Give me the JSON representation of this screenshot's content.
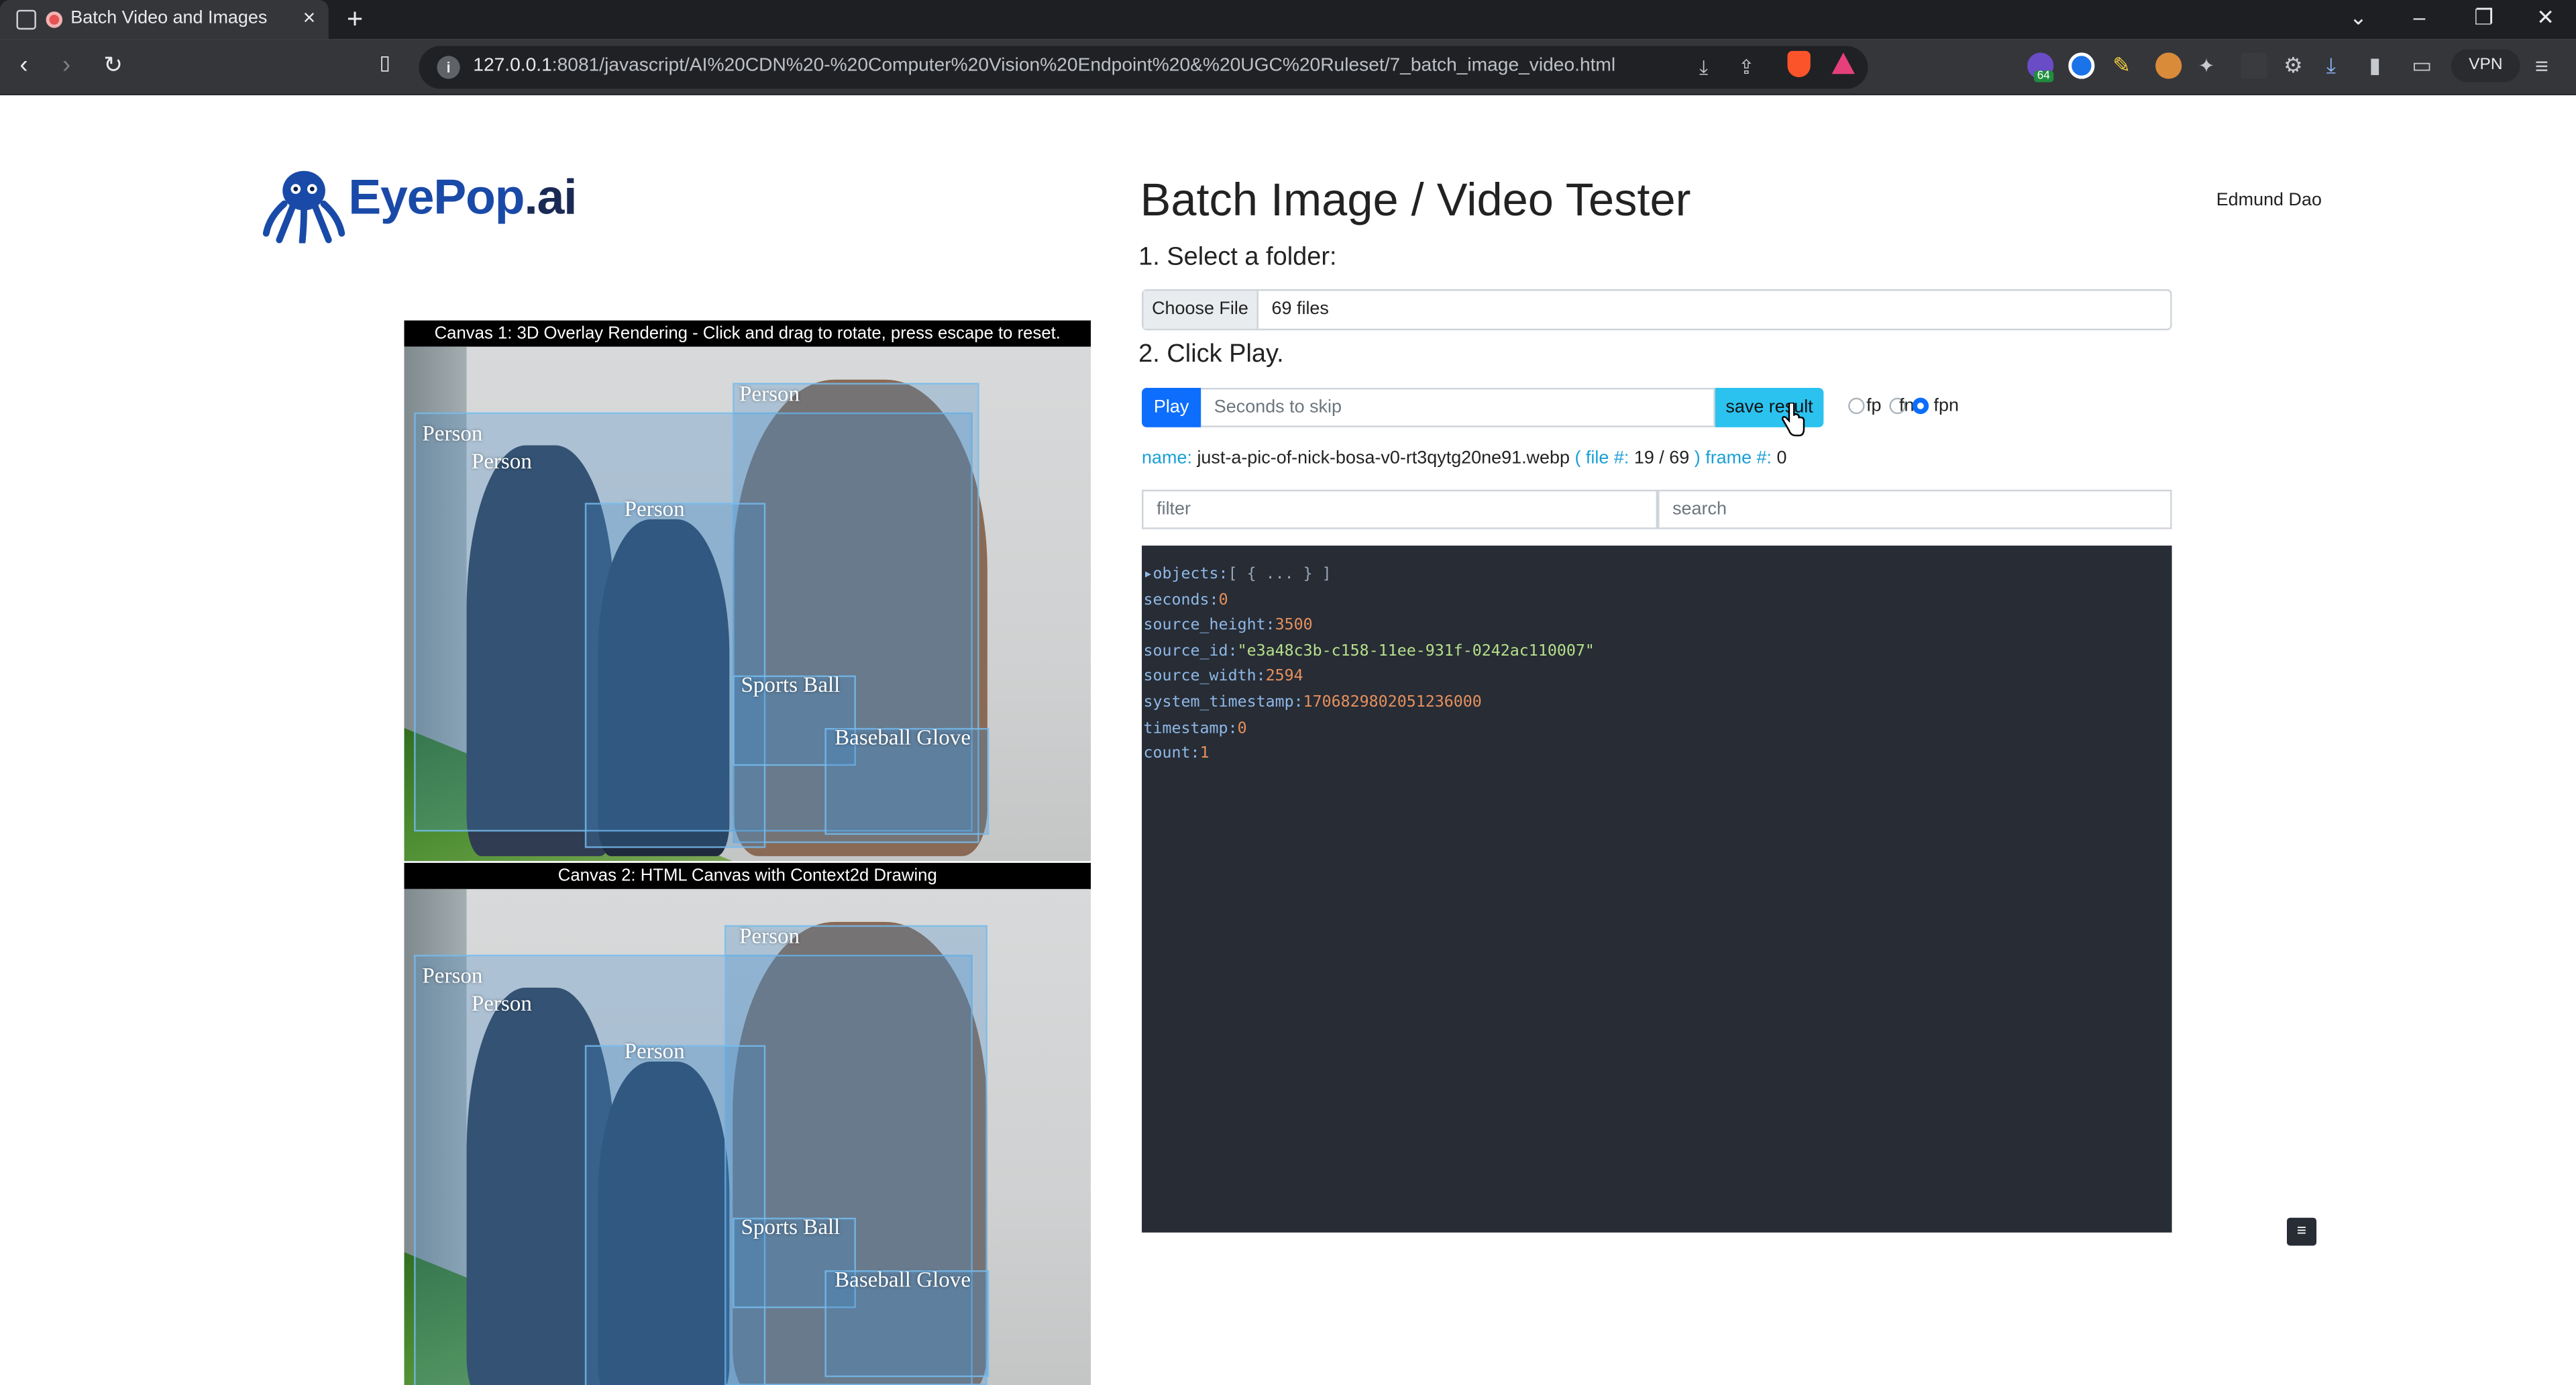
{
  "browser": {
    "tab_title": "Batch Video and Images",
    "close_glyph": "×",
    "new_tab_glyph": "+",
    "url_prefix": "127.0.0.1",
    "url_rest": ":8081/javascript/AI%20CDN%20-%20Computer%20Vision%20Endpoint%20&%20UGC%20Ruleset/7_batch_image_video.html",
    "vpn_label": "VPN",
    "ext_badge": "64"
  },
  "page": {
    "logo_text_a": "EyePop",
    "logo_text_b": ".ai",
    "title": "Batch Image / Video Tester",
    "user_name": "Edmund Dao",
    "step1": "1. Select a folder:",
    "choose_file": "Choose File",
    "files_count": "69 files",
    "step2": "2. Click Play.",
    "play": "Play",
    "skip_placeholder": "Seconds to skip",
    "save_result": "save result",
    "radio_fp": "fp",
    "radio_fn": "fn",
    "radio_fpn": "fpn",
    "selected_radio": "fpn",
    "meta": {
      "name_label": "name:",
      "name_value": "just-a-pic-of-nick-bosa-v0-rt3qytg20ne91.webp",
      "file_label": "( file #:",
      "file_value": "19 / 69",
      "file_close": ")",
      "frame_label": "frame #:",
      "frame_value": "0"
    },
    "filter_placeholder": "filter",
    "search_placeholder": "search",
    "json_lines": [
      {
        "key": "▸objects:",
        "val": "[ { ... } ]",
        "type": "br"
      },
      {
        "key": "seconds:",
        "val": "0",
        "type": "num"
      },
      {
        "key": "source_height:",
        "val": "3500",
        "type": "num"
      },
      {
        "key": "source_id:",
        "val": "\"e3a48c3b-c158-11ee-931f-0242ac110007\"",
        "type": "str"
      },
      {
        "key": "source_width:",
        "val": "2594",
        "type": "num"
      },
      {
        "key": "system_timestamp:",
        "val": "1706829802051236000",
        "type": "num"
      },
      {
        "key": "timestamp:",
        "val": "0",
        "type": "num"
      },
      {
        "key": "count:",
        "val": "1",
        "type": "num"
      }
    ],
    "menu_glyph": "≡"
  },
  "canvas1": {
    "caption": "Canvas 1: 3D Overlay Rendering - Click and drag to rotate, press escape to reset.",
    "labels": [
      "Person",
      "Person",
      "Person",
      "Person",
      "Sports Ball",
      "Baseball Glove"
    ]
  },
  "canvas2": {
    "caption": "Canvas 2: HTML Canvas with Context2d Drawing",
    "labels": [
      "Person",
      "Person",
      "Person",
      "Person",
      "Sports Ball",
      "Baseball Glove"
    ]
  },
  "colors": {
    "accent": "#0d6efd",
    "save": "#2bc2ef",
    "json_bg": "#272c35"
  },
  "icons": [
    "back-icon",
    "forward-icon",
    "reload-icon",
    "bookmark-icon",
    "info-icon",
    "download-icon",
    "share-icon",
    "brave-icon",
    "rewards-icon",
    "extensions-icon",
    "sidebar-icon",
    "wallet-icon",
    "menu-icon",
    "cursor-icon"
  ]
}
